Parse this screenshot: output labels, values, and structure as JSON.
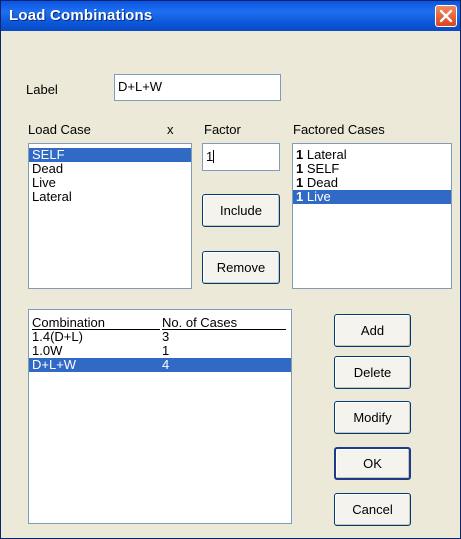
{
  "window": {
    "title": "Load Combinations"
  },
  "label_field": {
    "label": "Label",
    "value": "D+L+W"
  },
  "load_case": {
    "header": "Load Case",
    "x_header": "x",
    "items": [
      {
        "text": "SELF",
        "selected": true
      },
      {
        "text": "Dead",
        "selected": false
      },
      {
        "text": "Live",
        "selected": false
      },
      {
        "text": "Lateral",
        "selected": false
      }
    ]
  },
  "factor": {
    "header": "Factor",
    "value": "1"
  },
  "factored_cases": {
    "header": "Factored Cases",
    "items": [
      {
        "factor": "1",
        "name": "Lateral",
        "selected": false
      },
      {
        "factor": "1",
        "name": "SELF",
        "selected": false
      },
      {
        "factor": "1",
        "name": "Dead",
        "selected": false
      },
      {
        "factor": "1",
        "name": "Live",
        "selected": true
      }
    ]
  },
  "buttons": {
    "include": "Include",
    "remove": "Remove",
    "add": "Add",
    "delete": "Delete",
    "modify": "Modify",
    "ok": "OK",
    "cancel": "Cancel"
  },
  "combinations": {
    "headers": {
      "name": "Combination",
      "count": "No. of Cases"
    },
    "rows": [
      {
        "name": "1.4(D+L)",
        "count": "3",
        "selected": false
      },
      {
        "name": "1.0W",
        "count": "1",
        "selected": false
      },
      {
        "name": "D+L+W",
        "count": "4",
        "selected": true
      }
    ]
  },
  "colors": {
    "titlebar": "#0a54e0",
    "selection": "#316ac5",
    "dialog_bg": "#ece9d8"
  }
}
